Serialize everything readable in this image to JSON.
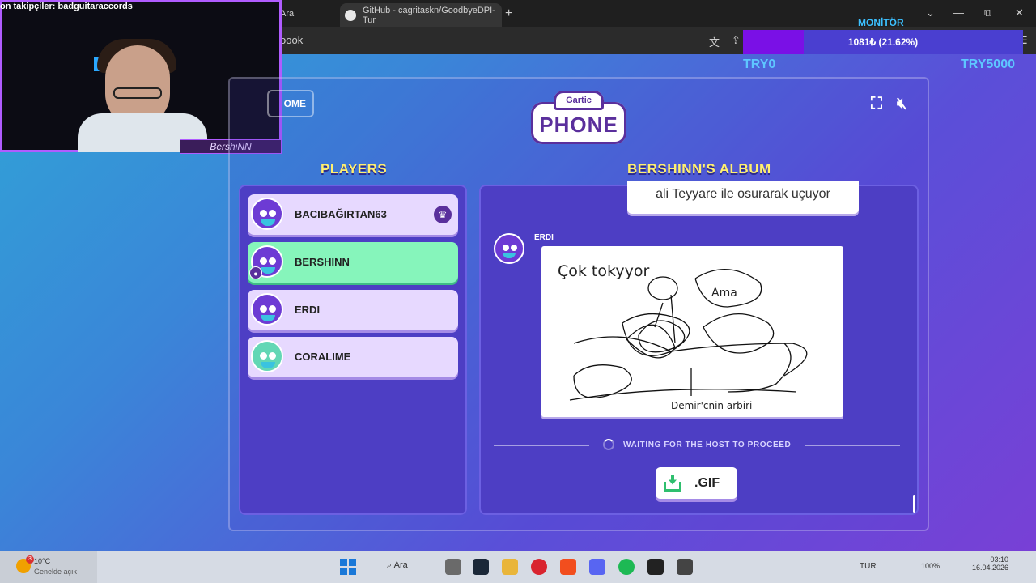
{
  "browser": {
    "tabs": [
      {
        "label": "Ara"
      },
      {
        "label": "GitHub - cagritaskn/GoodbyeDPI-Tur"
      }
    ],
    "new_tab": "+",
    "address_text": "oook",
    "window_controls": {
      "chevron": "⌄",
      "minimize": "—",
      "restore": "⧉",
      "close": "✕"
    }
  },
  "overlay": {
    "monitor_label": "MONİTÖR",
    "ticker_text": "1081₺ (21.62%)",
    "ticker_progress": 0.2162,
    "try_min": "TRY0",
    "try_max": "TRY5000",
    "webcam_title": "on takipçiler: badguitaraccords",
    "webcam_tag": "BershiNN"
  },
  "game": {
    "home_label": "OME",
    "logo_top": "Gartic",
    "logo_main": "PHONE",
    "players_title": "PLAYERS",
    "album_title": "BERSHINN'S ALBUM",
    "players": [
      {
        "name": "BACIBAĞIRTAN63",
        "host": true,
        "active": false,
        "you": false
      },
      {
        "name": "BERSHINN",
        "host": false,
        "active": true,
        "you": true
      },
      {
        "name": "ERDI",
        "host": false,
        "active": false,
        "you": false
      },
      {
        "name": "CORALIME",
        "host": false,
        "active": false,
        "you": false
      }
    ],
    "album": {
      "previous_text": "ali Teyyare ile osurarak uçuyor",
      "author": "ERDI",
      "drawing_text_top": "Çok tokyyor",
      "drawing_text_mid": "Ama",
      "drawing_text_bottom": "Demir'cnin arbiri"
    },
    "waiting_text": "WAITING FOR THE HOST TO PROCEED",
    "gif_label": ".GIF"
  },
  "taskbar": {
    "weather_temp": "10°C",
    "weather_desc": "Genelde açık",
    "weather_badge": "3",
    "search_label": "Ara",
    "language": "TUR",
    "battery": "100%",
    "time": "03:10",
    "date": "16.04.2026"
  },
  "colors": {
    "accent_green": "#86f5bb",
    "title_yellow": "#fff070",
    "panel_purple": "#4d3ec4"
  }
}
